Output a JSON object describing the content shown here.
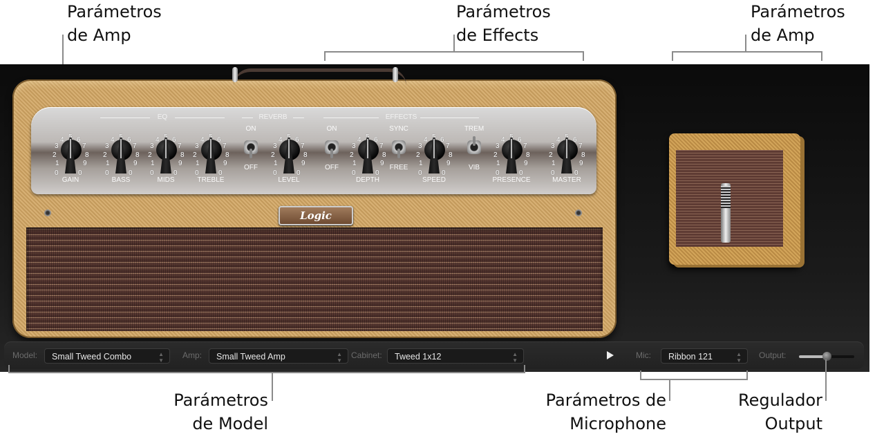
{
  "callouts": {
    "amp_left": [
      "Parámetros",
      "de Amp"
    ],
    "effects": [
      "Parámetros",
      "de Effects"
    ],
    "amp_right": [
      "Parámetros",
      "de Amp"
    ],
    "model": [
      "Parámetros",
      "de Model"
    ],
    "microphone": [
      "Parámetros de",
      "Microphone"
    ],
    "output": [
      "Regulador",
      "Output"
    ]
  },
  "amp": {
    "sections": {
      "eq": "EQ",
      "reverb": "REVERB",
      "effects": "EFFECTS"
    },
    "scale": [
      "0",
      "1",
      "2",
      "3",
      "4",
      "5",
      "6",
      "7",
      "8",
      "9",
      "10"
    ],
    "knobs": [
      {
        "id": "gain",
        "label": "GAIN",
        "value": 5
      },
      {
        "id": "bass",
        "label": "BASS",
        "value": 5
      },
      {
        "id": "mids",
        "label": "MIDS",
        "value": 5
      },
      {
        "id": "treble",
        "label": "TREBLE",
        "value": 5
      },
      {
        "id": "reverb-level",
        "label": "LEVEL",
        "value": 5
      },
      {
        "id": "depth",
        "label": "DEPTH",
        "value": 5
      },
      {
        "id": "speed",
        "label": "SPEED",
        "value": 5
      },
      {
        "id": "presence",
        "label": "PRESENCE",
        "value": 5
      },
      {
        "id": "master",
        "label": "MASTER",
        "value": 5
      }
    ],
    "toggles": [
      {
        "id": "reverb-on-off",
        "top": "ON",
        "bottom": "OFF",
        "state": "OFF"
      },
      {
        "id": "effects-on-off",
        "top": "ON",
        "bottom": "OFF",
        "state": "OFF"
      },
      {
        "id": "sync-free",
        "top": "SYNC",
        "bottom": "FREE",
        "state": "FREE"
      },
      {
        "id": "trem-vib",
        "top": "TREM",
        "bottom": "VIB",
        "state": "TREM"
      }
    ],
    "logo": "Logic"
  },
  "bottom_bar": {
    "model_label": "Model:",
    "model_value": "Small Tweed Combo",
    "amp_label": "Amp:",
    "amp_value": "Small Tweed Amp",
    "cabinet_label": "Cabinet:",
    "cabinet_value": "Tweed 1x12",
    "mic_label": "Mic:",
    "mic_value": "Ribbon 121",
    "output_label": "Output:",
    "output_value": 0.5,
    "stepper_icon": "⬍"
  }
}
